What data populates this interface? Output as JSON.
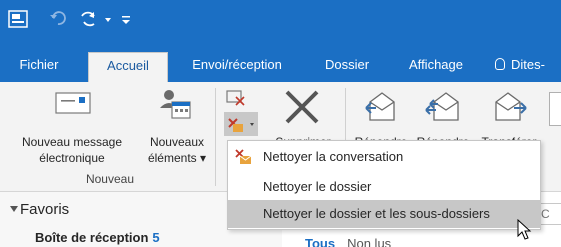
{
  "ribbon_tabs": {
    "fichier": "Fichier",
    "accueil": "Accueil",
    "envoi": "Envoi/réception",
    "dossier": "Dossier",
    "affichage": "Affichage",
    "tell_me": "Dites-"
  },
  "ribbon": {
    "new_message_line1": "Nouveau message",
    "new_message_line2": "électronique",
    "new_items_line1": "Nouveaux",
    "new_items_line2": "éléments",
    "delete": "Supprimer",
    "reply": "Répondre",
    "reply_all": "Répondre",
    "forward": "Transférer",
    "group_nouveau": "Nouveau"
  },
  "clean_up_menu": {
    "items": [
      "Nettoyer la conversation",
      "Nettoyer le dossier",
      "Nettoyer le dossier et les sous-dossiers"
    ],
    "hovered": "Nettoyer le dossier et les sous-dossiers"
  },
  "navigation": {
    "favorites_label": "Favoris",
    "inbox_label": "Boîte de réception",
    "inbox_unread_count": "5"
  },
  "message_list": {
    "search_placeholder": "e (C",
    "filter_all": "Tous",
    "filter_unread": "Non lus"
  },
  "colors": {
    "title_bar": "#1b6fc4",
    "ribbon_bg": "#f3f3f3",
    "menu_hover": "#c7c7c7",
    "unread_count": "#1b6fc4"
  }
}
